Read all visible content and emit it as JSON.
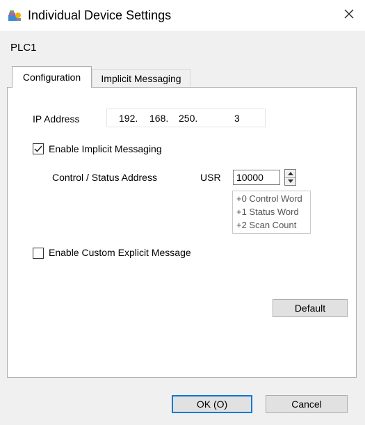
{
  "window": {
    "title": "Individual Device Settings",
    "icon": "settings-app-icon",
    "close_icon": "close-icon"
  },
  "device": {
    "name": "PLC1"
  },
  "tabs": [
    {
      "label": "Configuration",
      "active": true
    },
    {
      "label": "Implicit Messaging",
      "active": false
    }
  ],
  "config": {
    "ip_label": "IP Address",
    "ip_octets": [
      "192.",
      "168.",
      "250.",
      "3"
    ],
    "enable_implicit": {
      "label": "Enable Implicit Messaging",
      "checked": true
    },
    "control_status": {
      "label": "Control / Status Address",
      "prefix": "USR",
      "value": "10000"
    },
    "address_list": [
      "+0 Control Word",
      "+1 Status Word",
      "+2 Scan Count"
    ],
    "enable_custom_explicit": {
      "label": "Enable Custom Explicit Message",
      "checked": false
    },
    "default_button": "Default"
  },
  "footer": {
    "ok_label": "OK (O)",
    "cancel_label": "Cancel"
  }
}
